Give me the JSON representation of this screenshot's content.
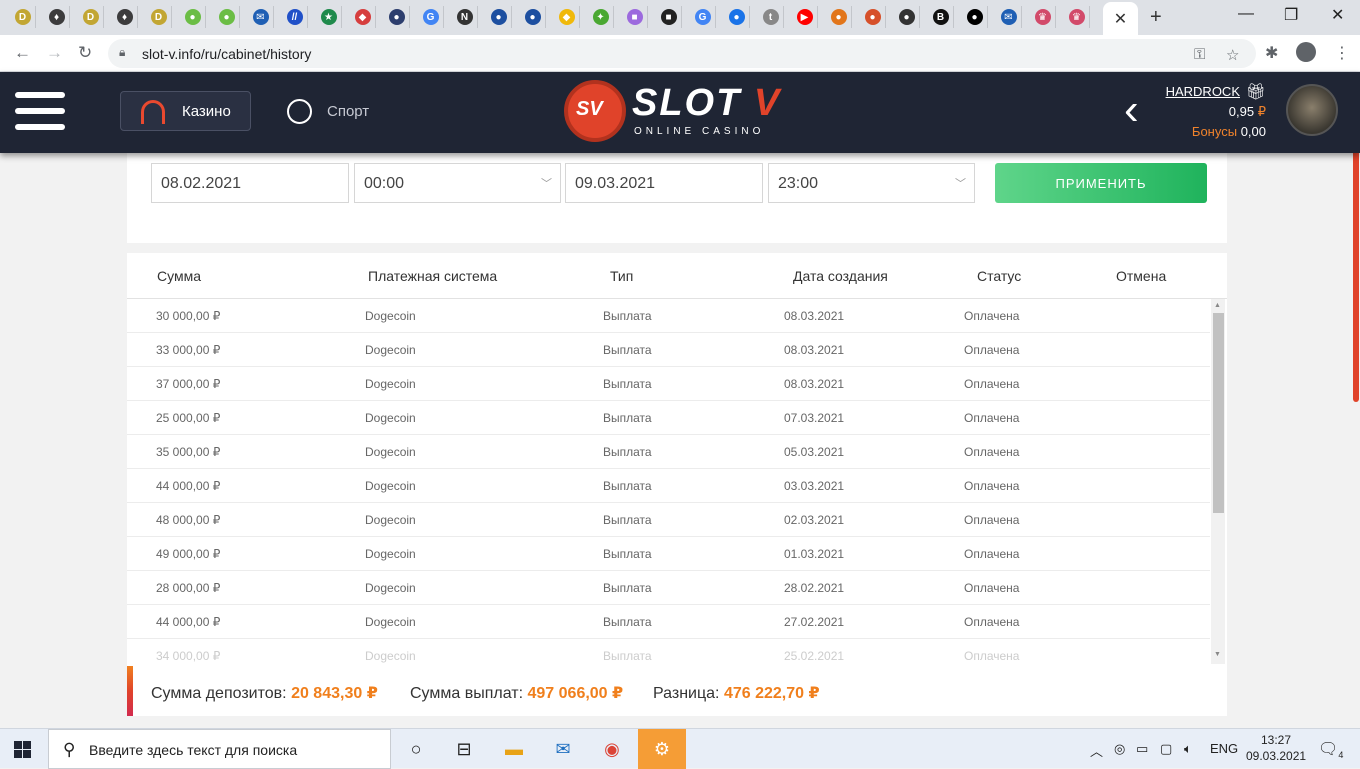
{
  "browser": {
    "url": "slot-v.info/ru/cabinet/history",
    "tab_favicons": [
      {
        "name": "dogecoin",
        "color": "#c2a633",
        "glyph": "D"
      },
      {
        "name": "ethereum",
        "color": "#3c3c3d",
        "glyph": "♦"
      },
      {
        "name": "dogecoin",
        "color": "#c2a633",
        "glyph": "D"
      },
      {
        "name": "ethereum",
        "color": "#3c3c3d",
        "glyph": "♦"
      },
      {
        "name": "dogecoin",
        "color": "#c2a633",
        "glyph": "D"
      },
      {
        "name": "green-app",
        "color": "#6bbd45",
        "glyph": "●"
      },
      {
        "name": "green-app",
        "color": "#6bbd45",
        "glyph": "●"
      },
      {
        "name": "mail",
        "color": "#1f5fb4",
        "glyph": "✉"
      },
      {
        "name": "blue-red",
        "color": "#2050c8",
        "glyph": "//"
      },
      {
        "name": "star",
        "color": "#1f8a4c",
        "glyph": "★"
      },
      {
        "name": "red-diamond",
        "color": "#d63e3e",
        "glyph": "◆"
      },
      {
        "name": "globe",
        "color": "#2d3e6e",
        "glyph": "●"
      },
      {
        "name": "google",
        "color": "#4285f4",
        "glyph": "G"
      },
      {
        "name": "news24",
        "color": "#333",
        "glyph": "N"
      },
      {
        "name": "drop",
        "color": "#1d4fa0",
        "glyph": "●"
      },
      {
        "name": "drop",
        "color": "#1d4fa0",
        "glyph": "●"
      },
      {
        "name": "binance",
        "color": "#f0b90b",
        "glyph": "◆"
      },
      {
        "name": "leaf",
        "color": "#4aa832",
        "glyph": "✦"
      },
      {
        "name": "purple-app",
        "color": "#9c6ade",
        "glyph": "■"
      },
      {
        "name": "grid",
        "color": "#222",
        "glyph": "■"
      },
      {
        "name": "google",
        "color": "#4285f4",
        "glyph": "G"
      },
      {
        "name": "chat",
        "color": "#1a73e8",
        "glyph": "●"
      },
      {
        "name": "tumblr",
        "color": "#888",
        "glyph": "t"
      },
      {
        "name": "youtube",
        "color": "#ff0000",
        "glyph": "▶"
      },
      {
        "name": "metamask",
        "color": "#e2761b",
        "glyph": "●"
      },
      {
        "name": "rainbow",
        "color": "#d6502a",
        "glyph": "●"
      },
      {
        "name": "bot",
        "color": "#333",
        "glyph": "●"
      },
      {
        "name": "bn",
        "color": "#111",
        "glyph": "B"
      },
      {
        "name": "medium",
        "color": "#000",
        "glyph": "●"
      },
      {
        "name": "mail",
        "color": "#1f5fb4",
        "glyph": "✉"
      },
      {
        "name": "crown",
        "color": "#d24a6a",
        "glyph": "♛"
      },
      {
        "name": "crown",
        "color": "#d24a6a",
        "glyph": "♛"
      }
    ]
  },
  "header": {
    "casino_label": "Казино",
    "sport_label": "Спорт",
    "logo_word": "SLOT",
    "logo_v": "V",
    "logo_sub": "ONLINE CASINO",
    "logo_badge": "SV",
    "username": "HARDROCK",
    "balance": "0,95",
    "currency": "₽",
    "bonus_label": "Бонусы",
    "bonus_value": "0,00"
  },
  "filter": {
    "date_from": "08.02.2021",
    "time_from": "00:00",
    "date_to": "09.03.2021",
    "time_to": "23:00",
    "apply_label": "ПРИМЕНИТЬ"
  },
  "table": {
    "columns": [
      "Сумма",
      "Платежная система",
      "Тип",
      "Дата создания",
      "Статус",
      "Отмена"
    ],
    "rows": [
      {
        "amount": "30 000,00",
        "system": "Dogecoin",
        "type": "Выплата",
        "date": "08.03.2021",
        "status": "Оплачена"
      },
      {
        "amount": "33 000,00",
        "system": "Dogecoin",
        "type": "Выплата",
        "date": "08.03.2021",
        "status": "Оплачена"
      },
      {
        "amount": "37 000,00",
        "system": "Dogecoin",
        "type": "Выплата",
        "date": "08.03.2021",
        "status": "Оплачена"
      },
      {
        "amount": "25 000,00",
        "system": "Dogecoin",
        "type": "Выплата",
        "date": "07.03.2021",
        "status": "Оплачена"
      },
      {
        "amount": "35 000,00",
        "system": "Dogecoin",
        "type": "Выплата",
        "date": "05.03.2021",
        "status": "Оплачена"
      },
      {
        "amount": "44 000,00",
        "system": "Dogecoin",
        "type": "Выплата",
        "date": "03.03.2021",
        "status": "Оплачена"
      },
      {
        "amount": "48 000,00",
        "system": "Dogecoin",
        "type": "Выплата",
        "date": "02.03.2021",
        "status": "Оплачена"
      },
      {
        "amount": "49 000,00",
        "system": "Dogecoin",
        "type": "Выплата",
        "date": "01.03.2021",
        "status": "Оплачена"
      },
      {
        "amount": "28 000,00",
        "system": "Dogecoin",
        "type": "Выплата",
        "date": "28.02.2021",
        "status": "Оплачена"
      },
      {
        "amount": "44 000,00",
        "system": "Dogecoin",
        "type": "Выплата",
        "date": "27.02.2021",
        "status": "Оплачена"
      },
      {
        "amount": "34 000,00",
        "system": "Dogecoin",
        "type": "Выплата",
        "date": "25.02.2021",
        "status": "Оплачена"
      }
    ]
  },
  "summary": {
    "deposits_label": "Сумма депозитов:",
    "deposits_value": "20 843,30",
    "payouts_label": "Сумма выплат:",
    "payouts_value": "497 066,00",
    "diff_label": "Разница:",
    "diff_value": "476 222,70",
    "currency": "₽"
  },
  "taskbar": {
    "search_placeholder": "Введите здесь текст для поиска",
    "lang": "ENG",
    "time": "13:27",
    "date": "09.03.2021",
    "notifications": "4"
  }
}
